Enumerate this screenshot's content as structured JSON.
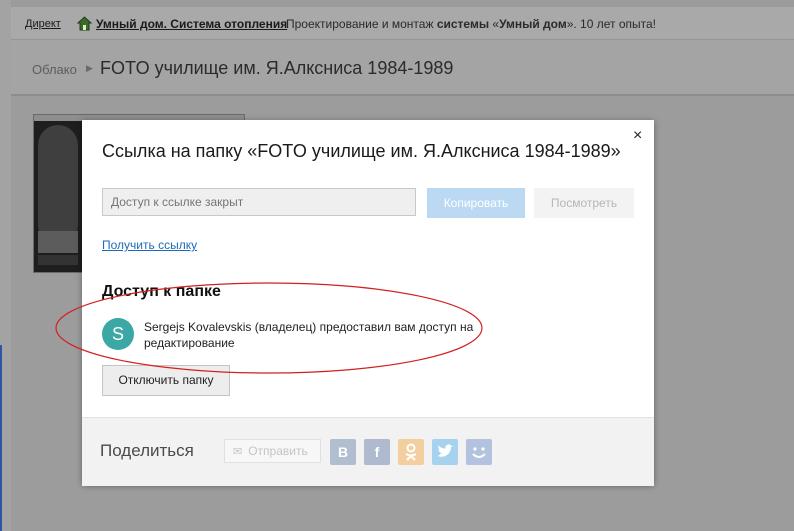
{
  "adbar": {
    "direct": "Директ",
    "ad_link": "Умный дом. Система отопления",
    "ad_text_1": "Проектирование и монтаж ",
    "ad_text_bold_1": "системы",
    "ad_text_2": " «",
    "ad_text_bold_2": "Умный дом",
    "ad_text_3": "». 10 лет опыта!",
    "home_icon": "home-icon"
  },
  "breadcrumb": {
    "root": "Облако",
    "separator_icon": "chevron-right-icon",
    "folder_title": "FOTO училище им. Я.Алксниса 1984-1989"
  },
  "dialog": {
    "close_glyph": "×",
    "title": "Ссылка на папку «FOTO училище им. Я.Алксниса 1984-1989»",
    "link_placeholder": "Доступ к ссылке закрыт",
    "copy_label": "Копировать",
    "view_label": "Посмотреть",
    "get_link_label": "Получить ссылку",
    "access_title": "Доступ к папке",
    "avatar_letter": "S",
    "owner_text": "Sergejs Kovalevskis (владелец) предоставил вам доступ на редактирование",
    "disable_label": "Отключить папку",
    "annotation_color": "#d42020"
  },
  "share": {
    "label": "Поделиться",
    "send_label": "Отправить",
    "services": [
      {
        "name": "vk",
        "glyph": "В",
        "color": "#b1bed0"
      },
      {
        "name": "facebook",
        "glyph": "f",
        "color": "#b0bace"
      },
      {
        "name": "odnoklassniki",
        "glyph": "ok",
        "color": "#f3cf9f"
      },
      {
        "name": "twitter",
        "glyph": "twitter-bird",
        "color": "#a6d2ee"
      },
      {
        "name": "moi-mir",
        "glyph": "mail-ru-face",
        "color": "#b3c3df"
      }
    ]
  }
}
